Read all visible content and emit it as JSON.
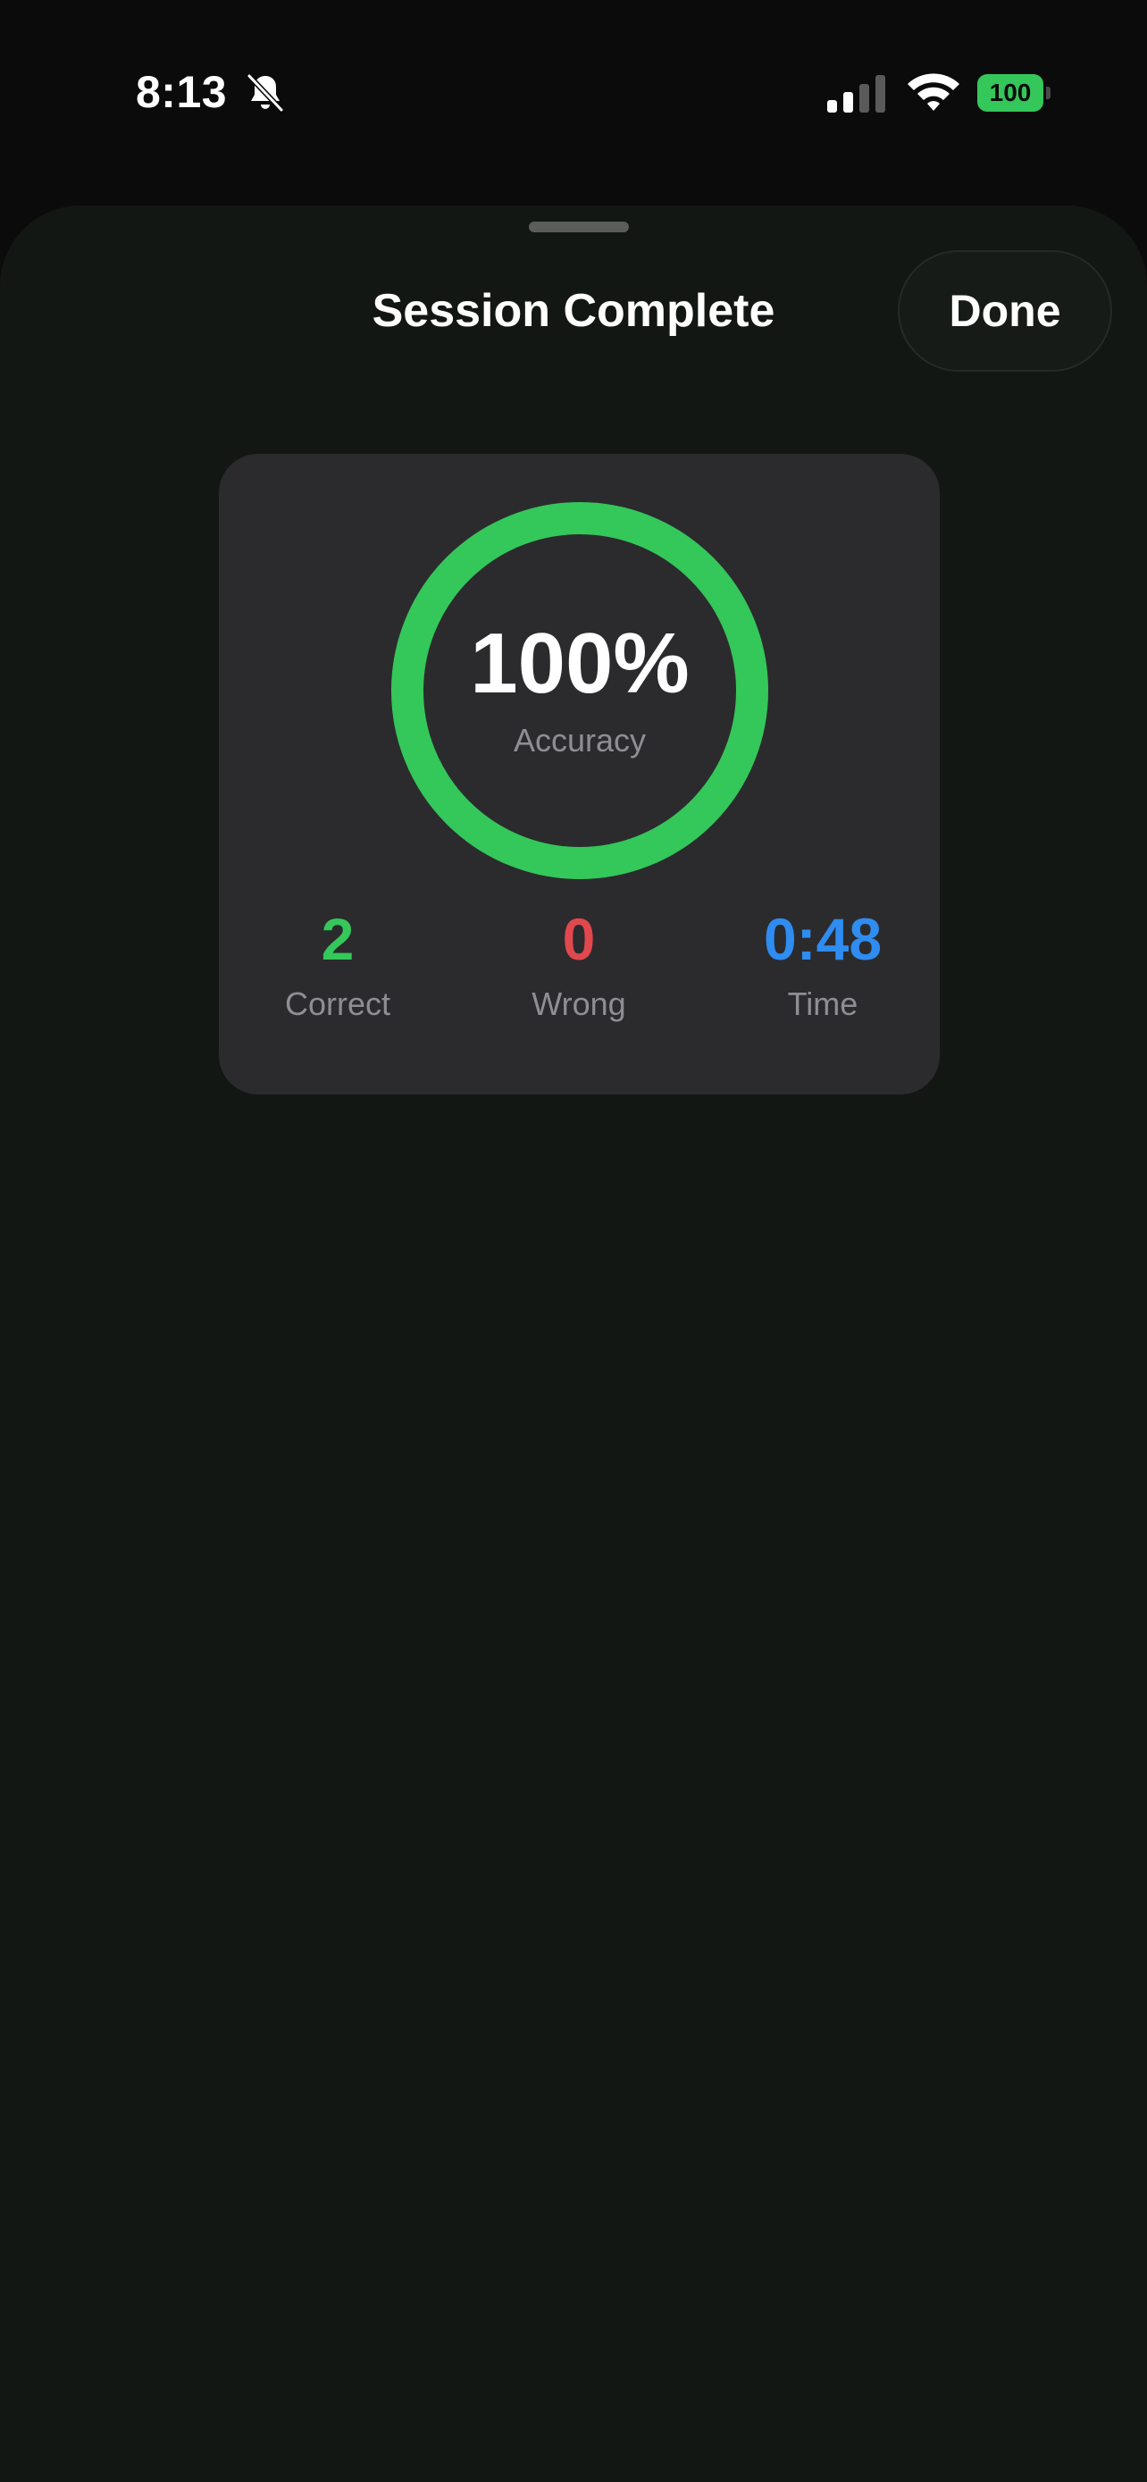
{
  "status_bar": {
    "time": "8:13",
    "battery": "100",
    "icons": [
      "bell-slash-icon",
      "cellular-signal-icon",
      "wifi-icon",
      "battery-icon"
    ]
  },
  "sheet": {
    "title": "Session Complete",
    "done_label": "Done"
  },
  "result": {
    "accuracy_value": "100%",
    "accuracy_label": "Accuracy",
    "accuracy_fraction": 1.0,
    "stats": {
      "correct": {
        "value": "2",
        "label": "Correct"
      },
      "wrong": {
        "value": "0",
        "label": "Wrong"
      },
      "time": {
        "value": "0:48",
        "label": "Time"
      }
    }
  },
  "colors": {
    "accent_green": "#34c759",
    "wrong_red": "#e0484e",
    "time_blue": "#2f8cf0",
    "card_background": "#2b2b2e",
    "sheet_background": "#131714"
  }
}
